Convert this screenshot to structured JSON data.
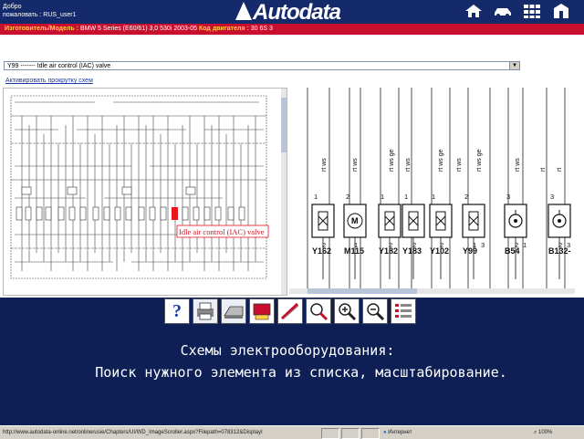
{
  "header": {
    "welcome_line1": "Добро",
    "welcome_line2": "пожаловать : RUS_user1",
    "logo": "Autodata",
    "nav_icons": [
      "home-icon",
      "car-icon",
      "grid-icon",
      "building-icon"
    ]
  },
  "vehicle_bar": {
    "model_label": "Изготовитель/Модель :",
    "model_value": "BMW 5 Series (E60/61) 3,0 530i 2003-05",
    "engine_label": "Код двигателя :",
    "engine_value": "30 6S 3"
  },
  "component_select": {
    "value": "Y99 ------- Idle air control (IAC) valve"
  },
  "scroll_link": "Активировать прокрутку схем",
  "diagram": {
    "highlight_label": "Idle air control (IAC) valve",
    "wire_labels": [
      "rt ws",
      "rt ws",
      "rt ws ge",
      "rt ws",
      "rt ws ge",
      "rt ws",
      "rt ws ge",
      "rt ws",
      "rt",
      "rt"
    ],
    "components": [
      {
        "id": "Y162",
        "type": "valve",
        "pins": [
          "1",
          "2"
        ]
      },
      {
        "id": "M115",
        "type": "motor",
        "pins": [
          "2",
          "1"
        ]
      },
      {
        "id": "Y182",
        "type": "valve",
        "pins": [
          "1",
          "2"
        ]
      },
      {
        "id": "Y183",
        "type": "valve",
        "pins": [
          "1",
          "2"
        ]
      },
      {
        "id": "Y102",
        "type": "valve",
        "pins": [
          "1",
          "2"
        ]
      },
      {
        "id": "Y99",
        "type": "valve",
        "pins": [
          "2",
          "1",
          "3"
        ]
      },
      {
        "id": "B54",
        "type": "sensor",
        "pins": [
          "3",
          "2",
          "1"
        ]
      },
      {
        "id": "B132-",
        "type": "sensor",
        "pins": [
          "3",
          "2",
          "3"
        ]
      }
    ]
  },
  "toolbar": {
    "tools": [
      {
        "name": "help-icon",
        "symbol": "?"
      },
      {
        "name": "print-icon",
        "symbol": ""
      },
      {
        "name": "scanner-icon",
        "symbol": ""
      },
      {
        "name": "component-location-icon",
        "symbol": ""
      },
      {
        "name": "wiring-icon",
        "symbol": ""
      },
      {
        "name": "zoom-fit-icon",
        "symbol": ""
      },
      {
        "name": "zoom-in-icon",
        "symbol": "+"
      },
      {
        "name": "zoom-out-icon",
        "symbol": "-"
      },
      {
        "name": "list-icon",
        "symbol": ""
      }
    ]
  },
  "caption": {
    "line1": "Схемы электрооборудования:",
    "line2": "Поиск нужного элемента из списка, масштабирование."
  },
  "status_bar": {
    "url": "http://www.autodata-online.net/onlinerusie/Chapters/UI/WD_ImageScroller.aspx?Filepath=078312&DisplayI",
    "zone": "Интернет",
    "zoom": "100%"
  },
  "colors": {
    "background": "#0d1f55",
    "vehicle_bar": "#c8102e",
    "vehicle_label": "#ffd23f",
    "highlight": "#e8141e"
  }
}
